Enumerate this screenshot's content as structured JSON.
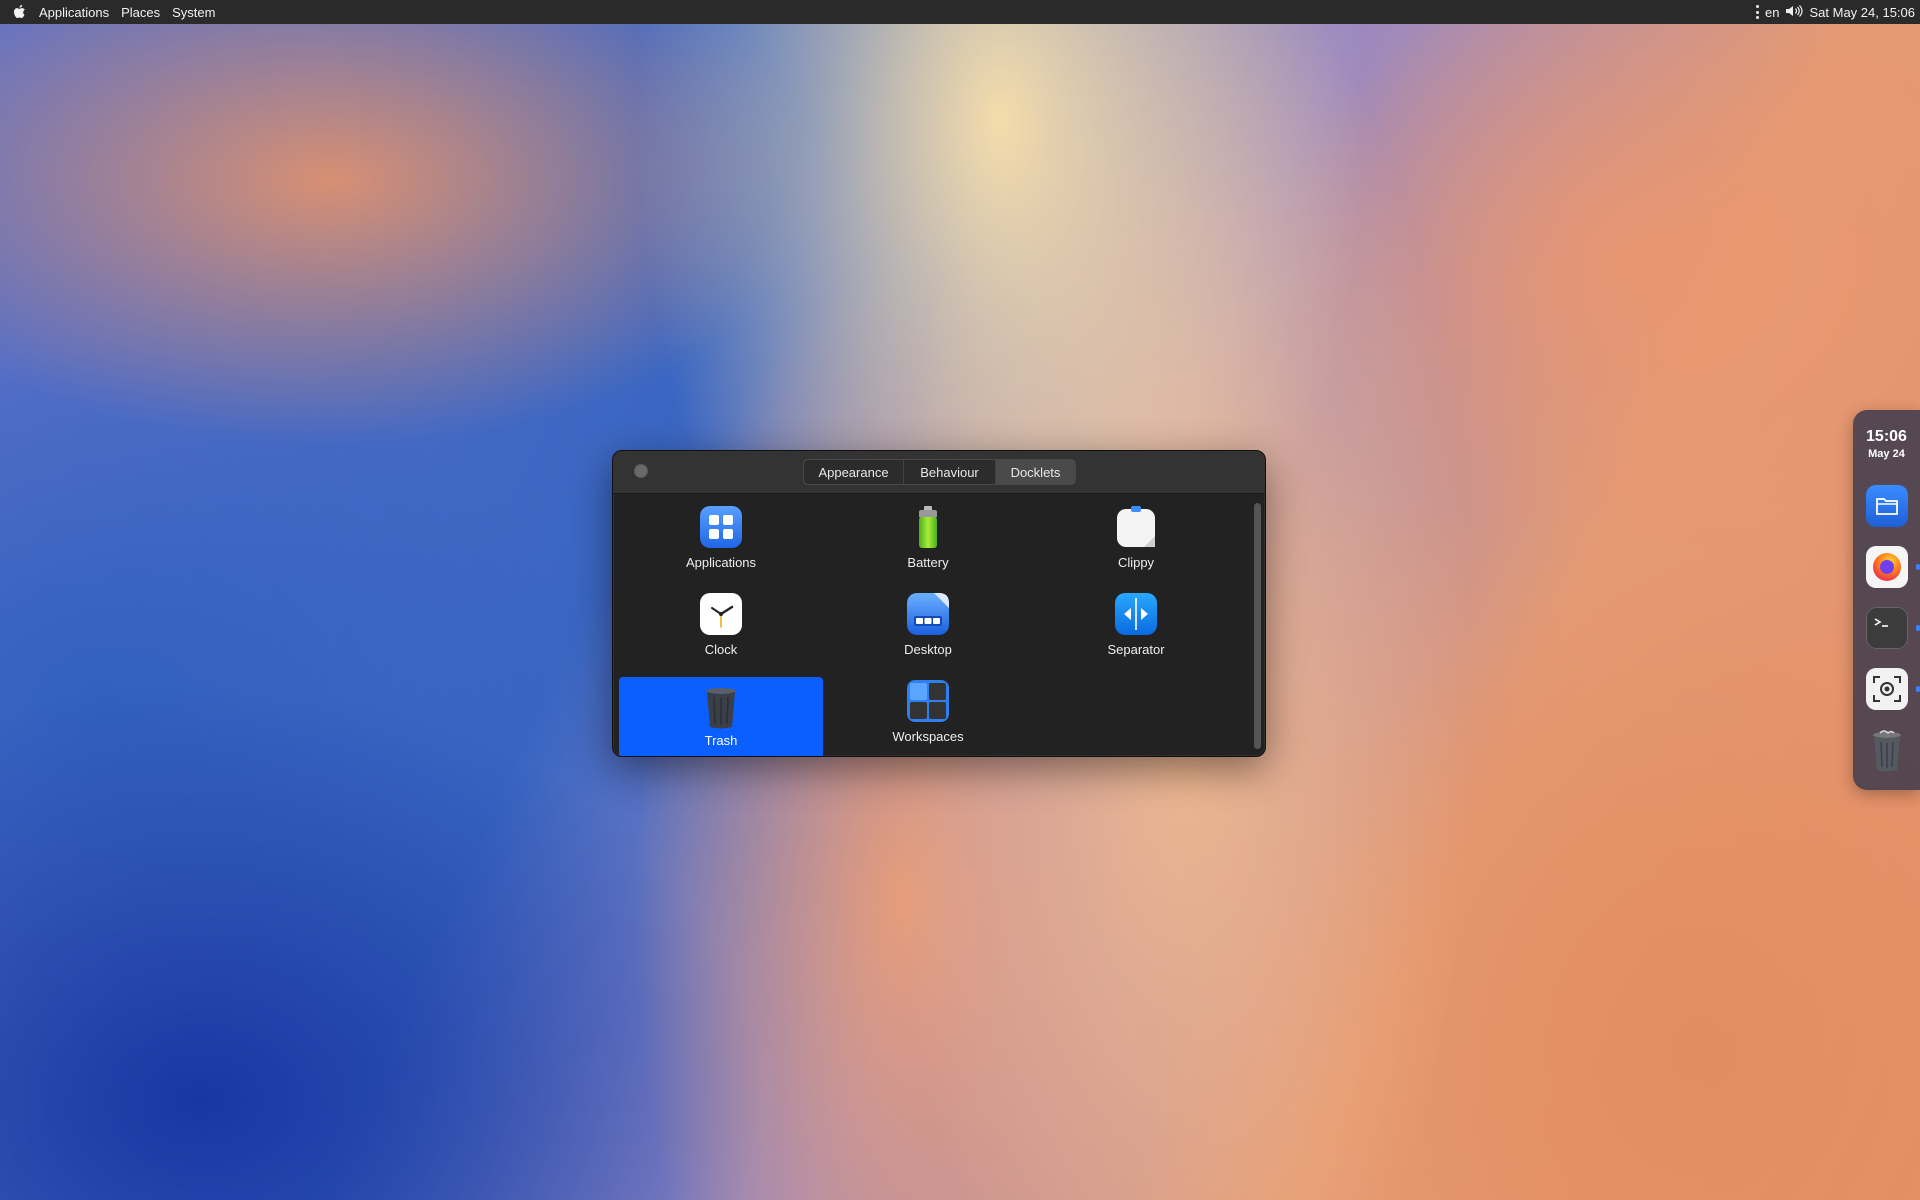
{
  "menubar": {
    "apple_icon": "apple-icon",
    "items": [
      "Applications",
      "Places",
      "System"
    ],
    "lang": "en",
    "clock": "Sat May 24, 15:06"
  },
  "window": {
    "tabs": [
      "Appearance",
      "Behaviour",
      "Docklets"
    ],
    "active_tab": "Docklets",
    "docklets": [
      {
        "label": "Applications",
        "icon": "applications-grid-icon"
      },
      {
        "label": "Battery",
        "icon": "battery-icon"
      },
      {
        "label": "Clippy",
        "icon": "clipboard-icon"
      },
      {
        "label": "Clock",
        "icon": "clock-icon"
      },
      {
        "label": "Desktop",
        "icon": "desktop-icon"
      },
      {
        "label": "Separator",
        "icon": "separator-icon"
      },
      {
        "label": "Trash",
        "icon": "trash-icon",
        "selected": true
      },
      {
        "label": "Workspaces",
        "icon": "workspaces-icon"
      }
    ],
    "selected_color": "#0b5fff"
  },
  "dock": {
    "time": "15:06",
    "date": "May 24",
    "items": [
      "files-icon",
      "firefox-icon",
      "terminal-icon",
      "screenshot-icon",
      "trash-icon"
    ]
  }
}
